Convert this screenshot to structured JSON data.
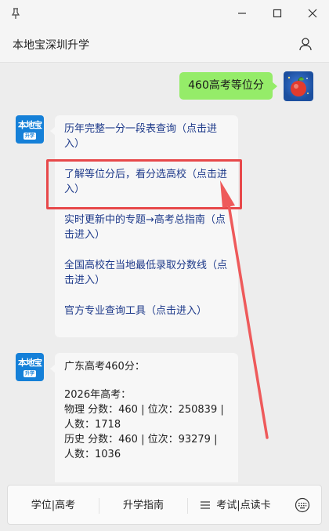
{
  "window": {
    "pin_icon": "pin-icon",
    "controls": [
      "minimize-icon",
      "maximize-icon",
      "close-icon"
    ]
  },
  "header": {
    "title": "本地宝深圳升学",
    "user_icon": "user-icon"
  },
  "chat": {
    "user_message": "460高考等位分",
    "bot_avatar_text": "本地宝",
    "bot_avatar_badge": "升学",
    "menu_links": [
      "历年完整一分一段表查询（点击进入）",
      "了解等位分后，看分选高校（点击进入）",
      "实时更新中的专题→高考总指南（点击进入）",
      "全国高校在当地最低录取分数线（点击进入）",
      "官方专业查询工具（点击进入）"
    ],
    "answer_lines": [
      "广东高考460分：",
      "",
      "2026年高考：",
      "物理 分数：460 | 位次：250839 | 人数：1718",
      "历史 分数：460 | 位次：93279 | 人数：1036"
    ]
  },
  "annotation": {
    "color": "#e7484a"
  },
  "bottom_menu": {
    "items": [
      "学位|高考",
      "升学指南",
      "考试|点读卡"
    ],
    "keyboard_icon": "keyboard-icon"
  }
}
